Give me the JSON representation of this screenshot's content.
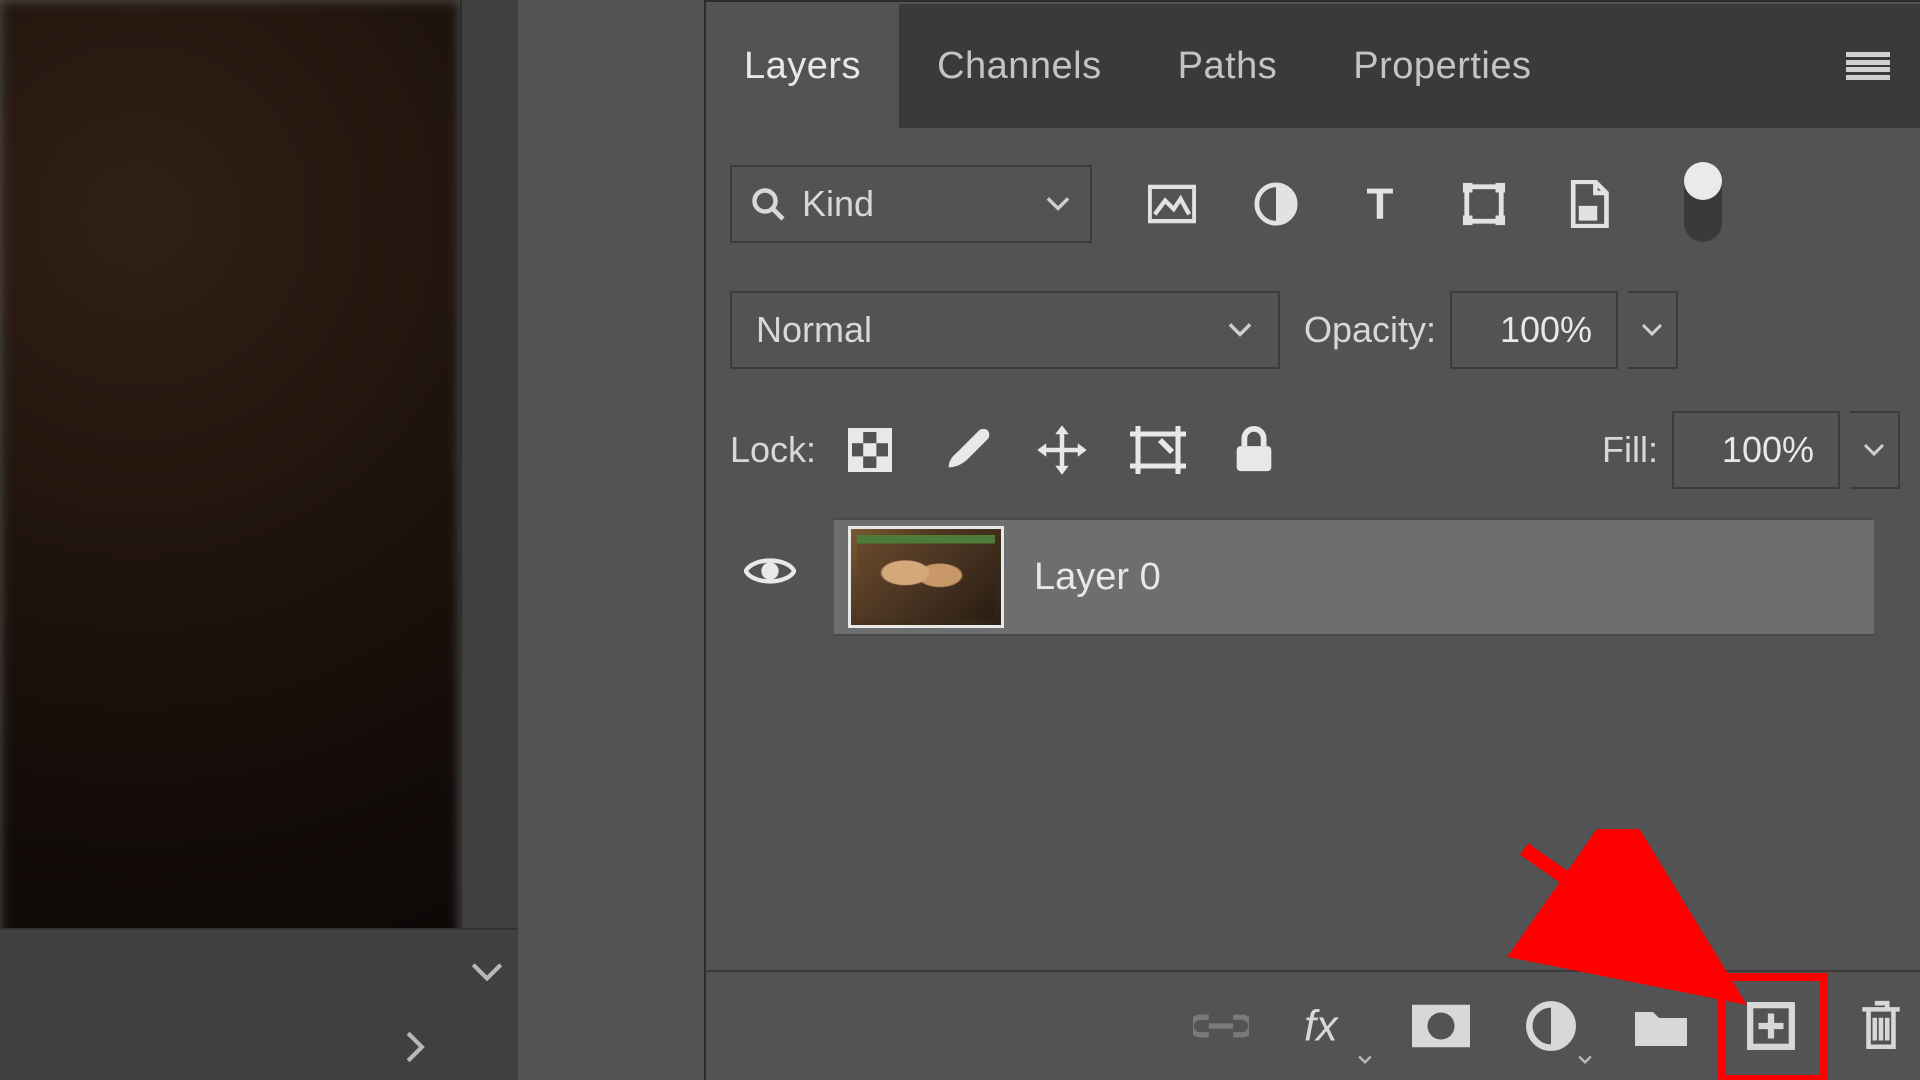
{
  "tabs": {
    "layers": "Layers",
    "channels": "Channels",
    "paths": "Paths",
    "properties": "Properties",
    "active": "layers"
  },
  "filter": {
    "kind_label": "Kind",
    "icons": [
      "image-filter-icon",
      "adjustment-filter-icon",
      "text-filter-icon",
      "shape-filter-icon",
      "smartobject-filter-icon"
    ]
  },
  "blend": {
    "mode": "Normal",
    "opacity_label": "Opacity:",
    "opacity_value": "100%"
  },
  "lock": {
    "label": "Lock:",
    "fill_label": "Fill:",
    "fill_value": "100%",
    "icons": [
      "lock-transparency-icon",
      "lock-paint-icon",
      "lock-position-icon",
      "lock-artboard-icon",
      "lock-all-icon"
    ]
  },
  "layers": [
    {
      "name": "Layer 0",
      "visible": true
    }
  ],
  "bottom": {
    "icons": [
      "link-layers-icon",
      "layer-effects-icon",
      "layer-mask-icon",
      "adjustment-layer-icon",
      "group-icon",
      "new-layer-icon",
      "delete-layer-icon"
    ]
  },
  "annotation": {
    "highlight_target": "new-layer-icon"
  }
}
